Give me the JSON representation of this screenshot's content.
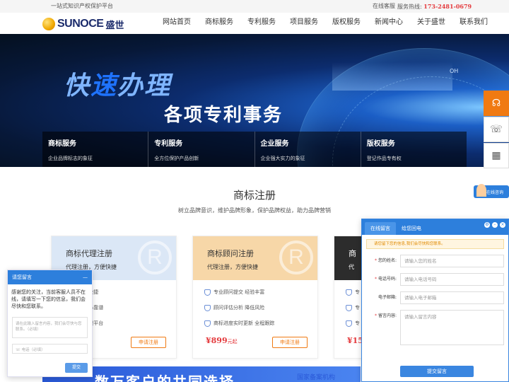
{
  "topbar": {
    "slogan": "一站式知识产权保护平台",
    "service": "在线客服",
    "hotline_label": "服务热线:",
    "hotline": "173-2481-0679"
  },
  "logo": {
    "en": "SUNOCE",
    "cn": "盛世"
  },
  "nav": [
    "网站首页",
    "商标服务",
    "专利服务",
    "项目服务",
    "版权服务",
    "新闻中心",
    "关于盛世",
    "联系我们"
  ],
  "hero": {
    "title_a": "快",
    "title_b": "速",
    "title_c": "办理",
    "subtitle": "各项专利事务",
    "tag": "OH"
  },
  "services": [
    {
      "title": "商标服务",
      "desc": "企业品牌标志的象征"
    },
    {
      "title": "专利服务",
      "desc": "全方位保护产品创新"
    },
    {
      "title": "企业服务",
      "desc": "企业强大实力的象征"
    },
    {
      "title": "版权服务",
      "desc": "登记作品专有权"
    }
  ],
  "consult": "在线咨询",
  "section": {
    "title": "商标注册",
    "subtitle": "树立品牌意识，维护品牌形象，保护品牌权益，助力品牌营销"
  },
  "cards": [
    {
      "title": "商标代理注册",
      "sub": "代理注册，方便快捷",
      "items": [
        "交 方便快捷",
        "平台 放心靠谱",
        "数据 正规平台"
      ],
      "price": "",
      "unit": "",
      "apply": "申请注册",
      "color": "#dbe7f6"
    },
    {
      "title": "商标顾问注册",
      "sub": "代理注册，方便快捷",
      "items": [
        "专业顾问提交 经验丰富",
        "顾问评估分析 降低风险",
        "商标进度实时更新 全程跟踪"
      ],
      "price": "¥899",
      "unit": "元起",
      "apply": "申请注册",
      "color": "#f7d7a8"
    },
    {
      "title": "商",
      "sub": "代",
      "items": [
        "专",
        "专",
        "专"
      ],
      "price": "¥15",
      "unit": "",
      "apply": "",
      "color": "#2c2c2c"
    }
  ],
  "banner": {
    "text": "数万客户的共同选择",
    "right": "国家备案机构"
  },
  "left_chat": {
    "title": "请您留言",
    "min": "—",
    "message": "感谢您的关注，当前客服人员不在线，请填写一下您的信息，我们会尽快和您联系。",
    "textarea_ph": "请在此输入留言内容，我们会尽快与您联系。（必填）",
    "phone_ph": "电话（必填）",
    "send": "提交"
  },
  "right_panel": {
    "tab1": "在线留言",
    "tab2": "给您回电",
    "notice": "请您留下您的信息,我们会尽快和您联系。",
    "fields": [
      {
        "label": "您的姓名:",
        "ph": "请输入您的姓名"
      },
      {
        "label": "电话号码:",
        "ph": "请输入电话号码"
      },
      {
        "label": "电子邮箱:",
        "ph": "请输入电子邮箱"
      },
      {
        "label": "留言内容:",
        "ph": "请输入留言内容"
      }
    ],
    "submit": "提交留言"
  }
}
